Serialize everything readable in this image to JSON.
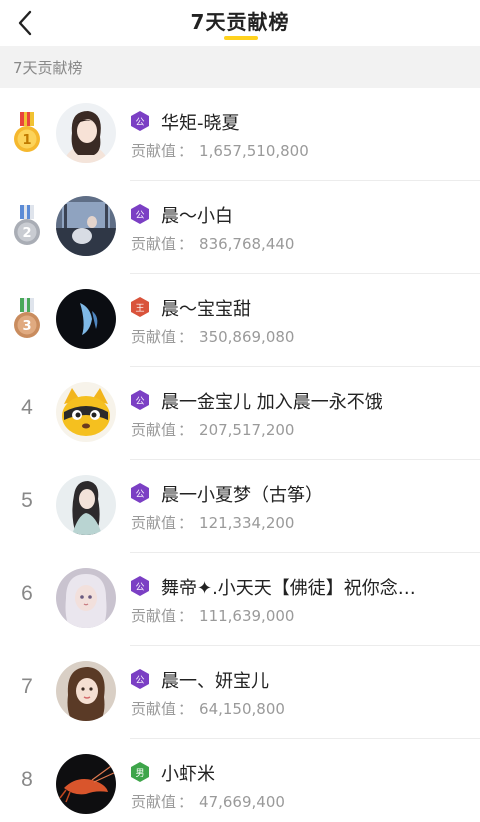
{
  "header": {
    "title": "7天贡献榜"
  },
  "section": {
    "label": "7天贡献榜"
  },
  "colors": {
    "accent": "#ffd21e",
    "badge_purple": "#7b3fc4",
    "badge_red": "#d9533b",
    "badge_green": "#3ea54a"
  },
  "contribution_label": "贡献值",
  "rankings": [
    {
      "rank": "1",
      "name": "华矩-晓夏",
      "value": "1,657,510,800",
      "badge": "公",
      "badge_color": "purple",
      "medal": "gold"
    },
    {
      "rank": "2",
      "name": "晨～小白",
      "value": "836,768,440",
      "badge": "公",
      "badge_color": "purple",
      "medal": "silver"
    },
    {
      "rank": "3",
      "name": "晨～宝宝甜",
      "value": "350,869,080",
      "badge": "王",
      "badge_color": "red",
      "medal": "bronze"
    },
    {
      "rank": "4",
      "name": "晨一金宝儿 加入晨一永不饿",
      "value": "207,517,200",
      "badge": "公",
      "badge_color": "purple"
    },
    {
      "rank": "5",
      "name": "晨一小夏梦（古筝）",
      "value": "121,334,200",
      "badge": "公",
      "badge_color": "purple"
    },
    {
      "rank": "6",
      "name": "舞帝✦.小天天【佛徒】祝你念…",
      "value": "111,639,000",
      "badge": "公",
      "badge_color": "purple"
    },
    {
      "rank": "7",
      "name": "晨一、妍宝儿",
      "value": "64,150,800",
      "badge": "公",
      "badge_color": "purple"
    },
    {
      "rank": "8",
      "name": "小虾米",
      "value": "47,669,400",
      "badge": "男",
      "badge_color": "green"
    }
  ]
}
